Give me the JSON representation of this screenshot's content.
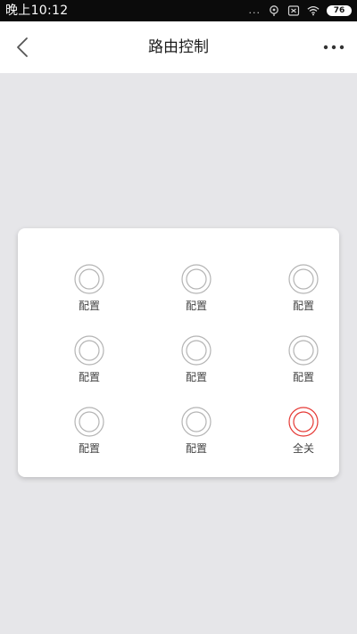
{
  "status_bar": {
    "time": "晚上10:12",
    "battery": "76",
    "more": "..."
  },
  "header": {
    "title": "路由控制"
  },
  "colors": {
    "ring_default": "#b4b4b4",
    "ring_active": "#e53935",
    "background": "#e6e6e9"
  },
  "controls": [
    {
      "label": "配置",
      "state": "default"
    },
    {
      "label": "配置",
      "state": "default"
    },
    {
      "label": "配置",
      "state": "default"
    },
    {
      "label": "配置",
      "state": "default"
    },
    {
      "label": "配置",
      "state": "default"
    },
    {
      "label": "配置",
      "state": "default"
    },
    {
      "label": "配置",
      "state": "default"
    },
    {
      "label": "配置",
      "state": "default"
    },
    {
      "label": "全关",
      "state": "active"
    }
  ]
}
